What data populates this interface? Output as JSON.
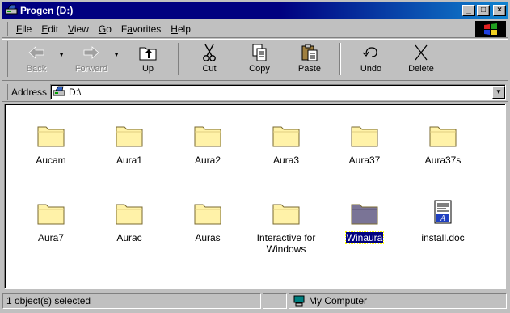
{
  "window": {
    "title": "Progen (D:)"
  },
  "titlebar_buttons": {
    "minimize": "_",
    "maximize": "□",
    "close": "×"
  },
  "menu": [
    "File",
    "Edit",
    "View",
    "Go",
    "Favorites",
    "Help"
  ],
  "menu_access": [
    "F",
    "E",
    "V",
    "G",
    "a",
    "H"
  ],
  "toolbar": {
    "back": "Back",
    "forward": "Forward",
    "up": "Up",
    "cut": "Cut",
    "copy": "Copy",
    "paste": "Paste",
    "undo": "Undo",
    "delete": "Delete"
  },
  "address": {
    "label": "Address",
    "value": "D:\\"
  },
  "items": [
    {
      "label": "Aucam",
      "type": "folder",
      "selected": false
    },
    {
      "label": "Aura1",
      "type": "folder",
      "selected": false
    },
    {
      "label": "Aura2",
      "type": "folder",
      "selected": false
    },
    {
      "label": "Aura3",
      "type": "folder",
      "selected": false
    },
    {
      "label": "Aura37",
      "type": "folder",
      "selected": false
    },
    {
      "label": "Aura37s",
      "type": "folder",
      "selected": false
    },
    {
      "label": "Aura7",
      "type": "folder",
      "selected": false
    },
    {
      "label": "Aurac",
      "type": "folder",
      "selected": false
    },
    {
      "label": "Auras",
      "type": "folder",
      "selected": false
    },
    {
      "label": "Interactive for Windows",
      "type": "folder",
      "selected": false
    },
    {
      "label": "Winaura",
      "type": "folder",
      "selected": true
    },
    {
      "label": "install.doc",
      "type": "document",
      "selected": false
    }
  ],
  "status": {
    "selection": "1 object(s) selected",
    "zone": "My Computer"
  },
  "colors": {
    "titlebar": "#000080",
    "folder": "#fff2a8",
    "folder_selected": "#7a7496",
    "selection": "#000080"
  }
}
